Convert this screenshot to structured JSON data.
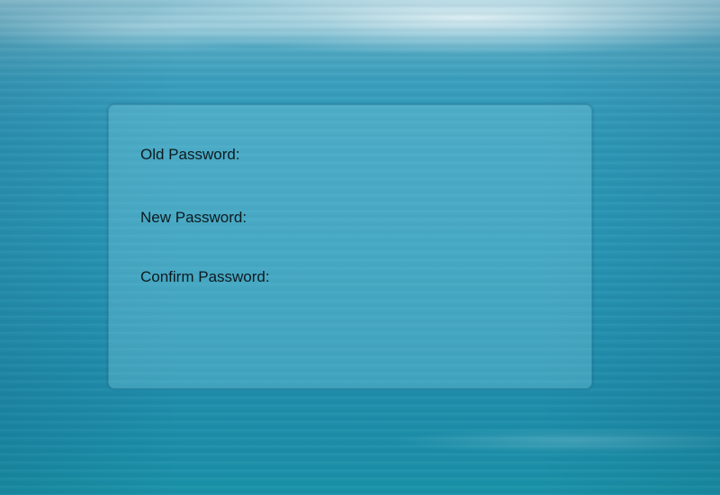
{
  "form": {
    "fields": [
      {
        "label": "Old Password:",
        "value": ""
      },
      {
        "label": "New Password:",
        "value": ""
      },
      {
        "label": "Confirm Password:",
        "value": ""
      }
    ]
  }
}
